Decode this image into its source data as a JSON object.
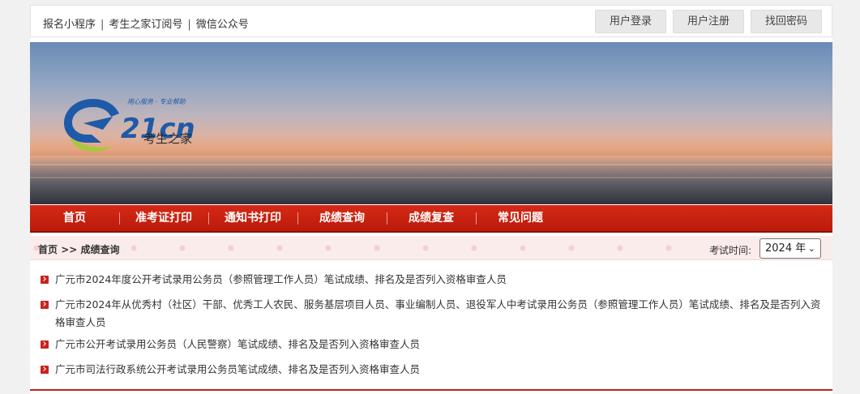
{
  "top_links": [
    "报名小程序",
    "考生之家订阅号",
    "微信公众号"
  ],
  "top_buttons": {
    "login": "用户登录",
    "register": "用户注册",
    "recover": "找回密码"
  },
  "logo": {
    "text": "21cn",
    "cn": "考生之家",
    "slogan": "用心服务 · 专业帮助"
  },
  "nav": [
    "首页",
    "准考证打印",
    "通知书打印",
    "成绩查询",
    "成绩复查",
    "常见问题"
  ],
  "breadcrumb": {
    "home": "首页",
    "arrow": ">>",
    "current": "成绩查询"
  },
  "exam_time": {
    "label": "考试时间:",
    "selected": "2024 年"
  },
  "items": [
    "广元市2024年度公开考试录用公务员（参照管理工作人员）笔试成绩、排名及是否列入资格审查人员",
    "广元市2024年从优秀村（社区）干部、优秀工人农民、服务基层项目人员、事业编制人员、退役军人中考试录用公务员（参照管理工作人员）笔试成绩、排名及是否列入资格审查人员",
    "广元市公开考试录用公务员（人民警察）笔试成绩、排名及是否列入资格审查人员",
    "广元市司法行政系统公开考试录用公务员笔试成绩、排名及是否列入资格审查人员"
  ],
  "colors": {
    "nav_red": "#c8231c",
    "crumb_bg": "#fbecec",
    "logo_blue": "#1e5aa8",
    "logo_green": "#a8c83a"
  }
}
